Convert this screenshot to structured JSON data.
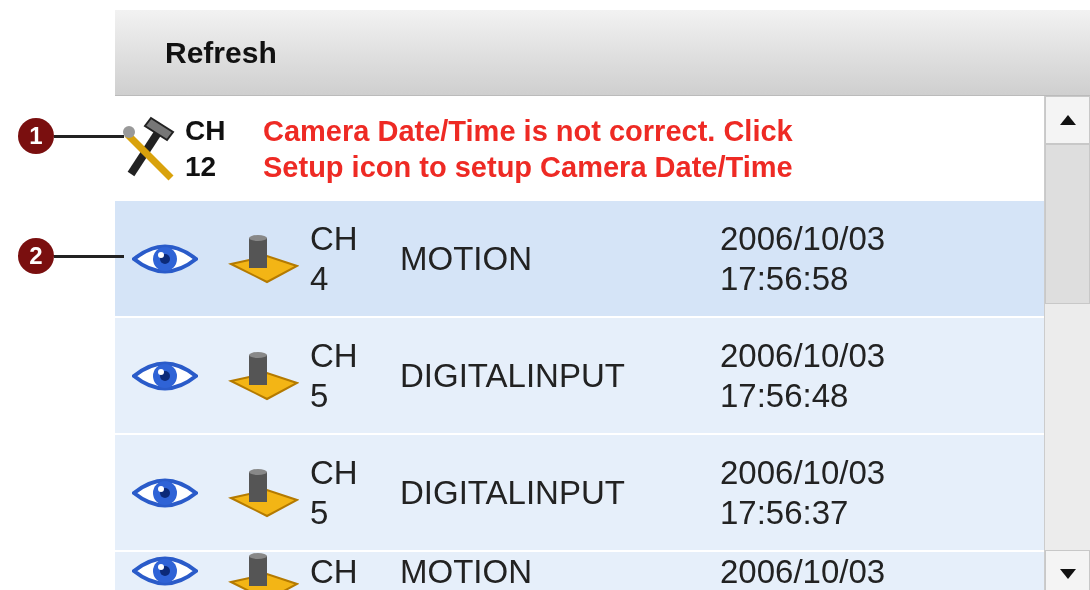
{
  "toolbar": {
    "refresh": "Refresh"
  },
  "callouts": [
    "1",
    "2"
  ],
  "alert": {
    "channel_label": "CH",
    "channel_number": "12",
    "message_lines": [
      "Camera Date/Time is not correct. Click",
      "Setup icon to setup Camera Date/Time"
    ]
  },
  "events": [
    {
      "channel_label": "CH",
      "channel_number": "4",
      "event": "MOTION",
      "date": "2006/10/03",
      "time": "17:56:58",
      "selected": true
    },
    {
      "channel_label": "CH",
      "channel_number": "5",
      "event": "DIGITALINPUT",
      "date": "2006/10/03",
      "time": "17:56:48",
      "selected": false
    },
    {
      "channel_label": "CH",
      "channel_number": "5",
      "event": "DIGITALINPUT",
      "date": "2006/10/03",
      "time": "17:56:37",
      "selected": false
    },
    {
      "channel_label": "CH",
      "event": "MOTION",
      "date": "2006/10/03",
      "selected": false
    }
  ]
}
